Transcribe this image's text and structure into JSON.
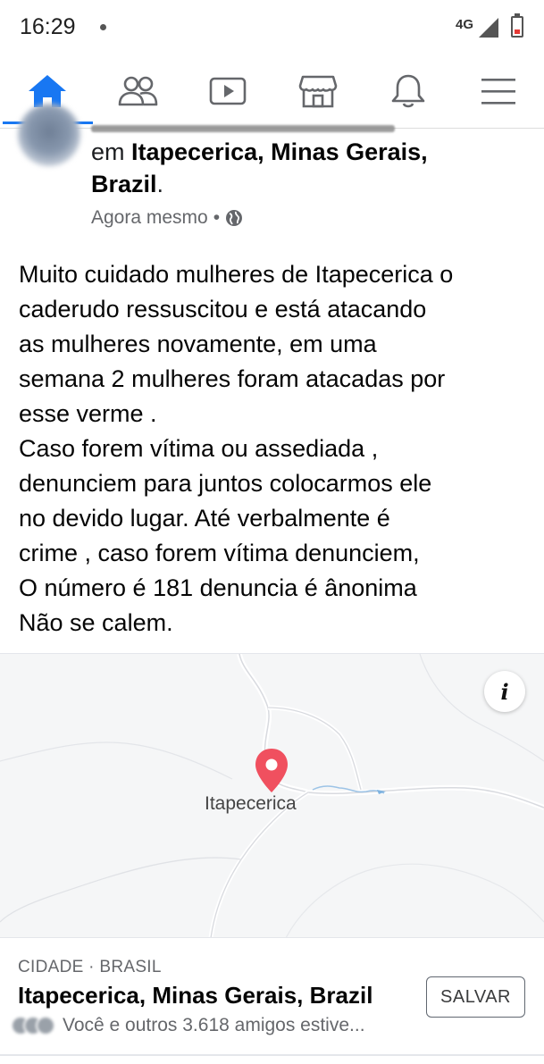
{
  "status_bar": {
    "time": "16:29",
    "network": "4G"
  },
  "nav": {
    "tabs": [
      {
        "name": "home",
        "icon": "home-icon",
        "active": true
      },
      {
        "name": "friends",
        "icon": "friends-icon",
        "active": false
      },
      {
        "name": "watch",
        "icon": "watch-icon",
        "active": false
      },
      {
        "name": "marketplace",
        "icon": "marketplace-icon",
        "active": false
      },
      {
        "name": "notifications",
        "icon": "bell-icon",
        "active": false
      },
      {
        "name": "menu",
        "icon": "menu-icon",
        "active": false
      }
    ],
    "active_color": "#1877f2",
    "inactive_color": "#65676b"
  },
  "post": {
    "checkin_prefix": "em ",
    "checkin_place_line1": "Itapecerica, Minas Gerais,",
    "checkin_place_line2": "Brazil",
    "checkin_suffix": ".",
    "timestamp": "Agora mesmo",
    "separator": "•",
    "privacy_icon": "globe-icon",
    "body_lines": [
      "Muito cuidado mulheres de Itapecerica o",
      "caderudo ressuscitou e está atacando",
      "as mulheres novamente, em uma",
      "semana 2 mulheres foram atacadas por",
      "esse verme .",
      "Caso forem vítima ou assediada ,",
      "denunciem para juntos colocarmos ele",
      "no devido lugar. Até verbalmente é",
      "crime , caso forem vítima denunciem,",
      "O número é 181 denuncia é ânonima",
      "Não se calem."
    ]
  },
  "map": {
    "label": "Itapecerica",
    "info_button": "i",
    "pin_color": "#f0505f"
  },
  "place_card": {
    "type": "CIDADE · BRASIL",
    "name": "Itapecerica, Minas Gerais, Brazil",
    "friends_text": "Você e outros 3.618 amigos estive...",
    "save_label": "SALVAR"
  }
}
